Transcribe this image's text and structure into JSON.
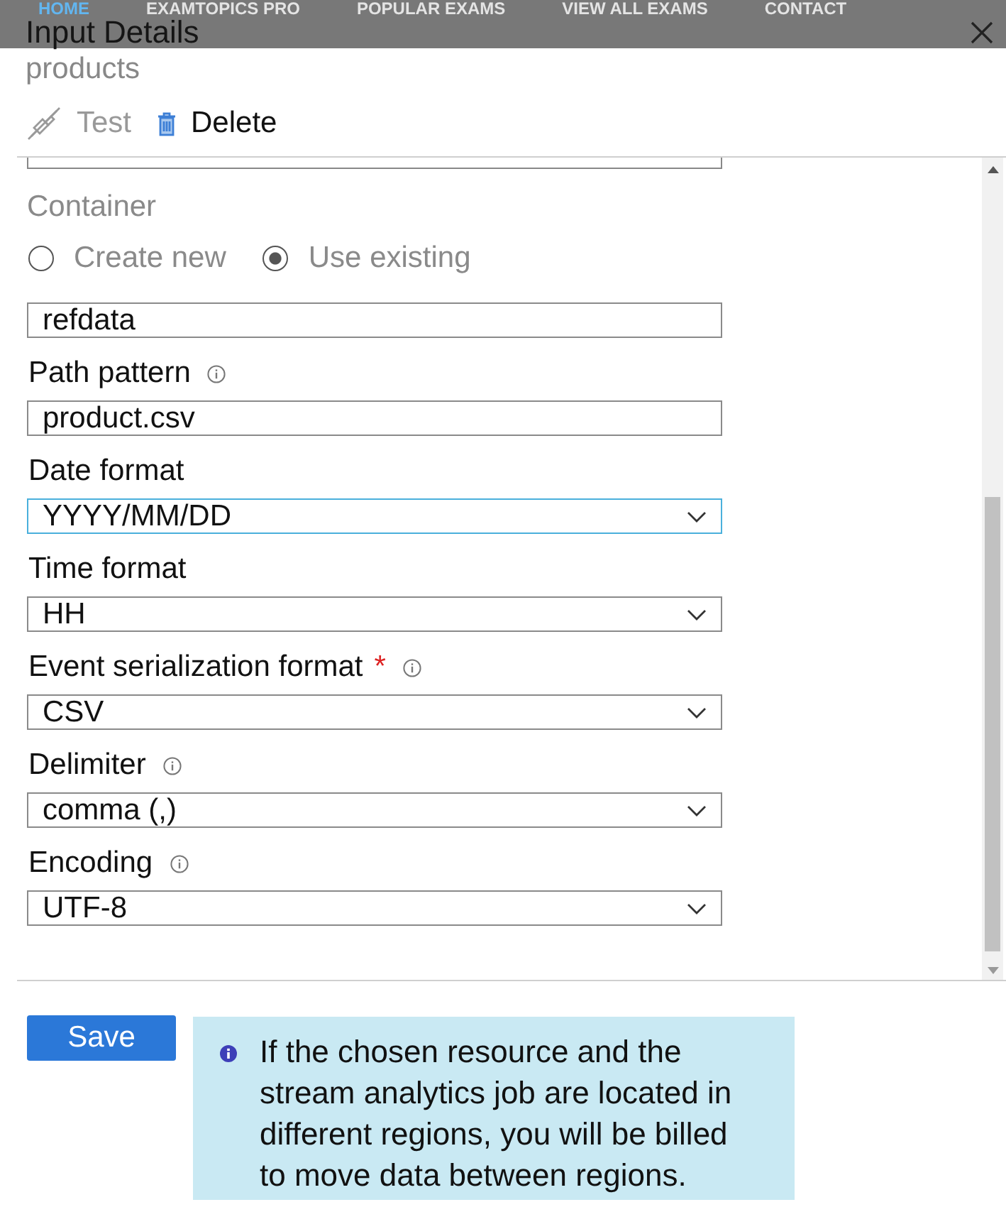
{
  "site_nav": {
    "items": [
      {
        "label": "HOME",
        "selected": true
      },
      {
        "label": "EXAMTOPICS PRO",
        "selected": false
      },
      {
        "label": "POPULAR EXAMS",
        "selected": false
      },
      {
        "label": "VIEW ALL EXAMS",
        "selected": false
      },
      {
        "label": "CONTACT",
        "selected": false
      }
    ]
  },
  "panel": {
    "title": "Input Details",
    "subtitle": "products"
  },
  "toolbar": [
    {
      "kind": "test",
      "label": "Test",
      "disabled": true
    },
    {
      "kind": "delete",
      "label": "Delete",
      "disabled": false
    }
  ],
  "form": {
    "container": {
      "label": "Container",
      "disabled": true,
      "options": [
        {
          "label": "Create new",
          "selected": false
        },
        {
          "label": "Use existing",
          "selected": true
        }
      ],
      "value": "refdata"
    },
    "fields": [
      {
        "kind": "text",
        "label": "Path pattern",
        "info": true,
        "value": "product.csv",
        "focused": false
      },
      {
        "kind": "select",
        "label": "Date format",
        "info": false,
        "value": "YYYY/MM/DD",
        "focused": true
      },
      {
        "kind": "select",
        "label": "Time format",
        "info": false,
        "value": "HH",
        "focused": false
      },
      {
        "kind": "select",
        "label": "Event serialization format",
        "required_mark": "*",
        "info": true,
        "value": "CSV",
        "focused": false
      },
      {
        "kind": "select",
        "label": "Delimiter",
        "info": true,
        "value": "comma (,)",
        "focused": false
      },
      {
        "kind": "select",
        "label": "Encoding",
        "info": true,
        "value": "UTF-8",
        "focused": false
      }
    ]
  },
  "save_button": "Save",
  "notice": "If the chosen resource and the stream analytics job are located in different regions, you will be billed to move data between regions."
}
